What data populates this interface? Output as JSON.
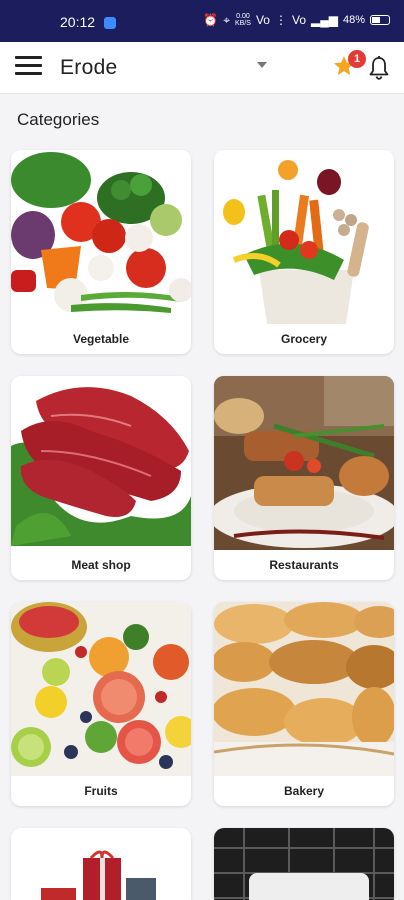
{
  "status_bar": {
    "time": "20:12",
    "net_speed_top": "0.00",
    "net_speed_bottom": "KB/S",
    "signal_1": "Vo",
    "signal_2": "Vo",
    "battery": "48%"
  },
  "app_bar": {
    "city": "Erode",
    "notification_count": "1"
  },
  "section_title": "Categories",
  "categories": [
    {
      "label": "Vegetable"
    },
    {
      "label": "Grocery"
    },
    {
      "label": "Meat shop"
    },
    {
      "label": "Restaurants"
    },
    {
      "label": "Fruits"
    },
    {
      "label": "Bakery"
    }
  ],
  "colors": {
    "status_bar": "#1b1d5c",
    "star": "#f5a623",
    "badge": "#e53935"
  }
}
